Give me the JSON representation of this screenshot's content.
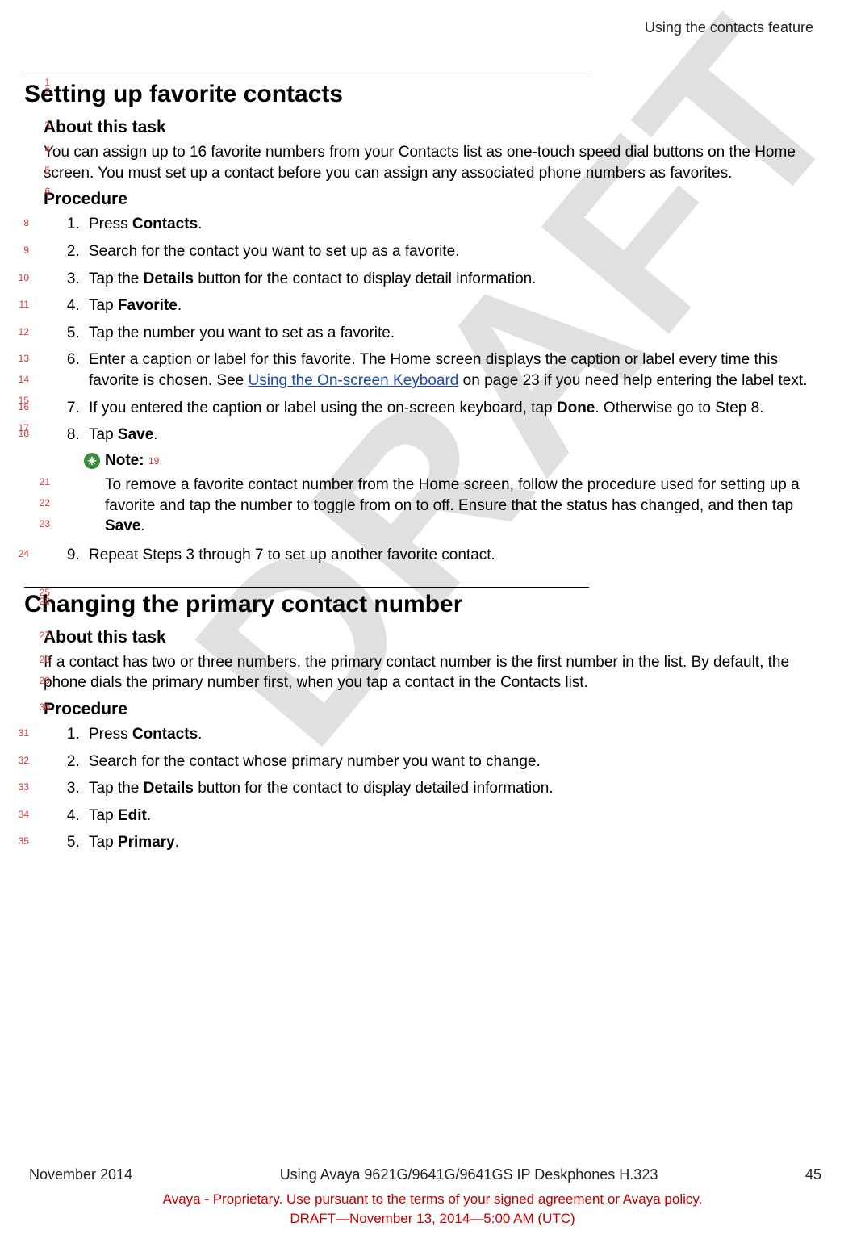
{
  "header": {
    "running_title": "Using the contacts feature"
  },
  "watermark": "DRAFT",
  "section1": {
    "title": "Setting up favorite contacts",
    "about_heading": "About this task",
    "about_text": "You can assign up to 16 favorite numbers from your Contacts list as one-touch speed dial buttons on the Home screen. You must set up a contact before you can assign any associated phone numbers as favorites.",
    "procedure_heading": "Procedure",
    "steps": {
      "s1_a": "Press ",
      "s1_b": "Contacts",
      "s1_c": ".",
      "s2": "Search for the contact you want to set up as a favorite.",
      "s3_a": "Tap the ",
      "s3_b": "Details",
      "s3_c": " button for the contact to display detail information.",
      "s4_a": "Tap ",
      "s4_b": "Favorite",
      "s4_c": ".",
      "s5": "Tap the number you want to set as a favorite.",
      "s6_a": "Enter a caption or label for this favorite. The Home screen displays the caption or label every time this favorite is chosen. See ",
      "s6_link": "Using the On-screen Keyboard",
      "s6_b": " on page 23 if you need help entering the label text.",
      "s7_a": "If you entered the caption or label using the on-screen keyboard, tap ",
      "s7_b": "Done",
      "s7_c": ". Otherwise go to Step 8.",
      "s8_a": "Tap ",
      "s8_b": "Save",
      "s8_c": ".",
      "note_label": "Note:",
      "note_body_a": "To remove a favorite contact number from the Home screen, follow the procedure used for setting up a favorite and tap the number to toggle from on to off. Ensure that the status has changed, and then tap ",
      "note_body_b": "Save",
      "note_body_c": ".",
      "s9": "Repeat Steps 3 through 7 to set up another favorite contact."
    }
  },
  "section2": {
    "title": "Changing the primary contact number",
    "about_heading": "About this task",
    "about_text": "If a contact has two or three numbers, the primary contact number is the first number in the list. By default, the phone dials the primary number first, when you tap a contact in the Contacts list.",
    "procedure_heading": "Procedure",
    "steps": {
      "s1_a": "Press ",
      "s1_b": "Contacts",
      "s1_c": ".",
      "s2": "Search for the contact whose primary number you want to change.",
      "s3_a": "Tap the ",
      "s3_b": "Details",
      "s3_c": " button for the contact to display detailed information.",
      "s4_a": "Tap ",
      "s4_b": "Edit",
      "s4_c": ".",
      "s5_a": "Tap ",
      "s5_b": "Primary",
      "s5_c": "."
    }
  },
  "footer": {
    "date": "November 2014",
    "doc_title": "Using Avaya 9621G/9641G/9641GS IP Deskphones H.323",
    "page_num": "45",
    "line2": "Avaya - Proprietary. Use pursuant to the terms of your signed agreement or Avaya policy.",
    "line3": "DRAFT—November 13, 2014—5:00 AM (UTC)"
  },
  "line_numbers": {
    "l1": "1",
    "l2": "2",
    "l3": "3",
    "l4": "4",
    "l5": "5",
    "l6": "6",
    "l7": "7",
    "l8": "8",
    "l9": "9",
    "l10": "10",
    "l11": "11",
    "l12": "12",
    "l13": "13",
    "l14": "14",
    "l15": "15",
    "l16": "16",
    "l17": "17",
    "l18": "18",
    "l19": "19",
    "l21": "21",
    "l22": "22",
    "l23": "23",
    "l24": "24",
    "l25": "25",
    "l26": "26",
    "l27": "27",
    "l28": "28",
    "l29": "29",
    "l30": "30",
    "l31": "31",
    "l32": "32",
    "l33": "33",
    "l34": "34",
    "l35": "35"
  }
}
